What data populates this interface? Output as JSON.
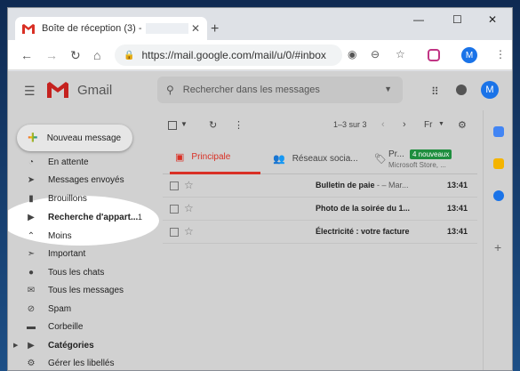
{
  "browser": {
    "tab_title": "Boîte de réception (3) -",
    "tab_close": "✕",
    "new_tab": "+",
    "window_controls": [
      "—",
      "☐",
      "✕"
    ],
    "url": "https://mail.google.com/mail/u/0/#inbox",
    "profile_initial": "M",
    "icons": [
      "back-arrow",
      "forward-arrow",
      "reload",
      "home",
      "lock",
      "eye",
      "zoom",
      "star",
      "instagram",
      "kebab-menu"
    ]
  },
  "gmail": {
    "brand": "Gmail",
    "search_placeholder": "Rechercher dans les messages",
    "avatar_initial": "M",
    "compose_label": "Nouveau message",
    "sidebar": [
      {
        "label": "En attente",
        "icon": "clock"
      },
      {
        "label": "Messages envoyés",
        "icon": "send"
      },
      {
        "label": "Brouillons",
        "icon": "draft"
      },
      {
        "label": "Recherche d'appart...",
        "icon": "label",
        "count": "1",
        "bold": true
      },
      {
        "label": "Moins",
        "icon": "chevron-up"
      },
      {
        "label": "Important",
        "icon": "important"
      },
      {
        "label": "Tous les chats",
        "icon": "chat"
      },
      {
        "label": "Tous les messages",
        "icon": "mail"
      },
      {
        "label": "Spam",
        "icon": "spam"
      },
      {
        "label": "Corbeille",
        "icon": "trash"
      },
      {
        "label": "Catégories",
        "icon": "label",
        "bold": true
      },
      {
        "label": "Gérer les libellés",
        "icon": "gear"
      }
    ],
    "toolbar": {
      "range": "1–3 sur 3",
      "lang": "Fr"
    },
    "tabs": [
      {
        "label": "Principale",
        "active": true
      },
      {
        "label": "Réseaux socia..."
      },
      {
        "label": "Pr...",
        "badge": "4 nouveaux",
        "sub": "Microsoft Store, ..."
      }
    ],
    "emails": [
      {
        "subject": "Bulletin de paie",
        "snippet": " - – Mar...",
        "time": "13:41"
      },
      {
        "subject": "Photo de la soirée du 1...",
        "snippet": "",
        "time": "13:41"
      },
      {
        "subject": "Électricité : votre facture",
        "snippet": "",
        "time": "13:41"
      }
    ]
  },
  "colors": {
    "gmail_red": "#d93025",
    "blue": "#1a73e8",
    "green_badge": "#1e8e3e"
  }
}
